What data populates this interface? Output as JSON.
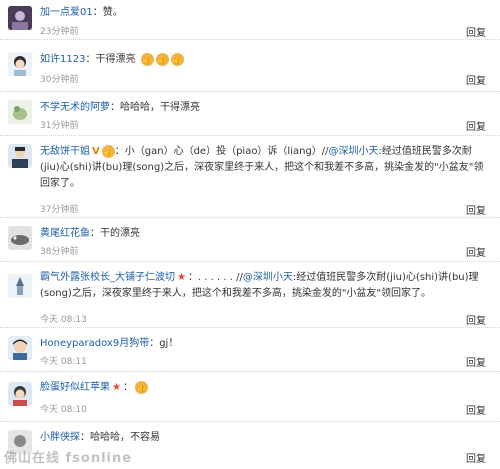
{
  "reply_label": "回复",
  "comments": [
    {
      "name": "加一点爱01",
      "text": "：赞。",
      "time": "23分钟前"
    },
    {
      "name": "如许1123",
      "text": "：干得漂亮",
      "time": "30分钟前"
    },
    {
      "name": "不学无术的阿萝",
      "text": "：哈哈哈，干得漂亮",
      "time": "31分钟前"
    },
    {
      "name": "无敌饼干姐",
      "badge": "V",
      "text_a": "：小（gan）心（de）投（piao）诉（liang）//",
      "mention": "@深圳小天",
      "text_b": ":经过值班民警多次耐(jiu)心(shi)讲(bu)理(song)之后，深夜家里终于来人，把这个和我差不多高，挑染金发的\"小盆友\"领回家了。",
      "time": "37分钟前"
    },
    {
      "name": "黄尾红花鱼",
      "text": "：干的漂亮",
      "time": "38分钟前"
    },
    {
      "name": "霸气外露张校长_大铺子仁波切",
      "text_a": "：. . . . . . //",
      "mention": "@深圳小天",
      "text_b": ":经过值班民警多次耐(jiu)心(shi)讲(bu)理(song)之后，深夜家里终于来人，把这个和我差不多高，挑染金发的\"小盆友\"领回家了。",
      "time": "今天 08:13"
    },
    {
      "name": "Honeyparadox9月狗带",
      "text": "：gj！",
      "time": "今天 08:11"
    },
    {
      "name": "脸蛋好似红苹果",
      "text": "：",
      "time": "今天 08:10"
    },
    {
      "name": "小胖侠探",
      "text": "：哈哈哈，不容易",
      "time": ""
    }
  ],
  "watermark": "佛山在线 fsonline"
}
